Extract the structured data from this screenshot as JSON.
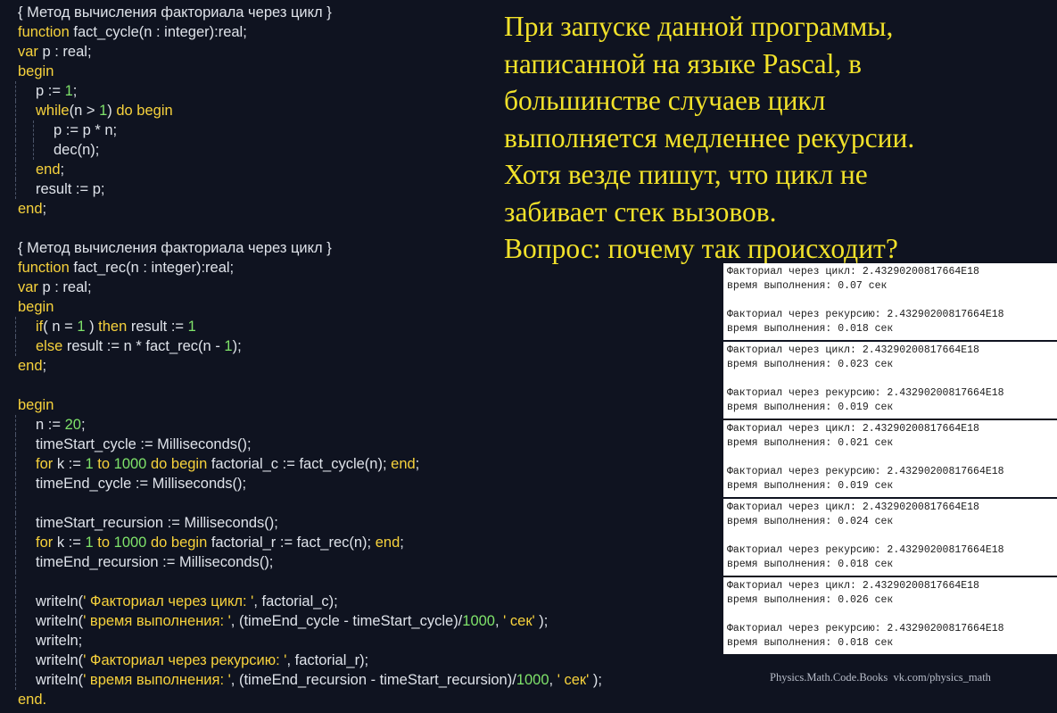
{
  "code_lines": [
    {
      "indent": 0,
      "tokens": [
        [
          "plain",
          "{ Метод вычисления факториала через цикл }"
        ]
      ]
    },
    {
      "indent": 0,
      "tokens": [
        [
          "kw",
          "function"
        ],
        [
          "plain",
          " fact_cycle(n : integer):real;"
        ]
      ]
    },
    {
      "indent": 0,
      "tokens": [
        [
          "kw",
          "var"
        ],
        [
          "plain",
          " p : real;"
        ]
      ]
    },
    {
      "indent": 0,
      "tokens": [
        [
          "kw",
          "begin"
        ]
      ]
    },
    {
      "indent": 1,
      "tokens": [
        [
          "plain",
          "p := "
        ],
        [
          "num",
          "1"
        ],
        [
          "plain",
          ";"
        ]
      ]
    },
    {
      "indent": 1,
      "tokens": [
        [
          "kw",
          "while"
        ],
        [
          "plain",
          "(n > "
        ],
        [
          "num",
          "1"
        ],
        [
          "plain",
          ") "
        ],
        [
          "kw",
          "do begin"
        ]
      ]
    },
    {
      "indent": 2,
      "tokens": [
        [
          "plain",
          "p := p * n;"
        ]
      ]
    },
    {
      "indent": 2,
      "tokens": [
        [
          "plain",
          "dec(n);"
        ]
      ]
    },
    {
      "indent": 1,
      "tokens": [
        [
          "kw",
          "end"
        ],
        [
          "plain",
          ";"
        ]
      ]
    },
    {
      "indent": 1,
      "tokens": [
        [
          "plain",
          "result := p;"
        ]
      ]
    },
    {
      "indent": 0,
      "tokens": [
        [
          "kw",
          "end"
        ],
        [
          "plain",
          ";"
        ]
      ]
    },
    {
      "indent": 0,
      "tokens": []
    },
    {
      "indent": 0,
      "tokens": [
        [
          "plain",
          "{ Метод вычисления факториала через цикл }"
        ]
      ]
    },
    {
      "indent": 0,
      "tokens": [
        [
          "kw",
          "function"
        ],
        [
          "plain",
          " fact_rec(n : integer):real;"
        ]
      ]
    },
    {
      "indent": 0,
      "tokens": [
        [
          "kw",
          "var"
        ],
        [
          "plain",
          " p : real;"
        ]
      ]
    },
    {
      "indent": 0,
      "tokens": [
        [
          "kw",
          "begin"
        ]
      ]
    },
    {
      "indent": 1,
      "tokens": [
        [
          "kw",
          "if"
        ],
        [
          "plain",
          "( n = "
        ],
        [
          "num",
          "1"
        ],
        [
          "plain",
          " ) "
        ],
        [
          "kw",
          "then"
        ],
        [
          "plain",
          " result := "
        ],
        [
          "num",
          "1"
        ]
      ]
    },
    {
      "indent": 1,
      "tokens": [
        [
          "kw",
          "else"
        ],
        [
          "plain",
          " result := n * fact_rec(n - "
        ],
        [
          "num",
          "1"
        ],
        [
          "plain",
          ");"
        ]
      ]
    },
    {
      "indent": 0,
      "tokens": [
        [
          "kw",
          "end"
        ],
        [
          "plain",
          ";"
        ]
      ]
    },
    {
      "indent": 0,
      "tokens": []
    },
    {
      "indent": 0,
      "tokens": [
        [
          "kw",
          "begin"
        ]
      ]
    },
    {
      "indent": 1,
      "tokens": [
        [
          "plain",
          "n := "
        ],
        [
          "num",
          "20"
        ],
        [
          "plain",
          ";"
        ]
      ]
    },
    {
      "indent": 1,
      "tokens": [
        [
          "plain",
          "timeStart_cycle := Milliseconds();"
        ]
      ]
    },
    {
      "indent": 1,
      "tokens": [
        [
          "kw",
          "for"
        ],
        [
          "plain",
          " k := "
        ],
        [
          "num",
          "1"
        ],
        [
          "plain",
          " "
        ],
        [
          "kw",
          "to"
        ],
        [
          "plain",
          " "
        ],
        [
          "num",
          "1000"
        ],
        [
          "plain",
          " "
        ],
        [
          "kw",
          "do begin"
        ],
        [
          "plain",
          " factorial_c := fact_cycle(n); "
        ],
        [
          "kw",
          "end"
        ],
        [
          "plain",
          ";"
        ]
      ]
    },
    {
      "indent": 1,
      "tokens": [
        [
          "plain",
          "timeEnd_cycle := Milliseconds();"
        ]
      ]
    },
    {
      "indent": 1,
      "tokens": []
    },
    {
      "indent": 1,
      "tokens": [
        [
          "plain",
          "timeStart_recursion := Milliseconds();"
        ]
      ]
    },
    {
      "indent": 1,
      "tokens": [
        [
          "kw",
          "for"
        ],
        [
          "plain",
          " k := "
        ],
        [
          "num",
          "1"
        ],
        [
          "plain",
          " "
        ],
        [
          "kw",
          "to"
        ],
        [
          "plain",
          " "
        ],
        [
          "num",
          "1000"
        ],
        [
          "plain",
          " "
        ],
        [
          "kw",
          "do begin"
        ],
        [
          "plain",
          " factorial_r := fact_rec(n); "
        ],
        [
          "kw",
          "end"
        ],
        [
          "plain",
          ";"
        ]
      ]
    },
    {
      "indent": 1,
      "tokens": [
        [
          "plain",
          "timeEnd_recursion := Milliseconds();"
        ]
      ]
    },
    {
      "indent": 1,
      "tokens": []
    },
    {
      "indent": 1,
      "tokens": [
        [
          "plain",
          "writeln("
        ],
        [
          "kw",
          "' Факториал через цикл: '"
        ],
        [
          "plain",
          ", factorial_c);"
        ]
      ]
    },
    {
      "indent": 1,
      "tokens": [
        [
          "plain",
          "writeln("
        ],
        [
          "kw",
          "' время выполнения: '"
        ],
        [
          "plain",
          ", (timeEnd_cycle - timeStart_cycle)/"
        ],
        [
          "num",
          "1000"
        ],
        [
          "plain",
          ", "
        ],
        [
          "kw",
          "' сек'"
        ],
        [
          "plain",
          " );"
        ]
      ]
    },
    {
      "indent": 1,
      "tokens": [
        [
          "plain",
          "writeln;"
        ]
      ]
    },
    {
      "indent": 1,
      "tokens": [
        [
          "plain",
          "writeln("
        ],
        [
          "kw",
          "' Факториал через рекурсию: '"
        ],
        [
          "plain",
          ", factorial_r);"
        ]
      ]
    },
    {
      "indent": 1,
      "tokens": [
        [
          "plain",
          "writeln("
        ],
        [
          "kw",
          "' время выполнения: '"
        ],
        [
          "plain",
          ", (timeEnd_recursion - timeStart_recursion)/"
        ],
        [
          "num",
          "1000"
        ],
        [
          "plain",
          ", "
        ],
        [
          "kw",
          "' сек'"
        ],
        [
          "plain",
          " );"
        ]
      ]
    },
    {
      "indent": 0,
      "tokens": [
        [
          "kw",
          "end."
        ]
      ]
    }
  ],
  "question_lines": [
    "При запуске данной программы,",
    "написанной на языке Pascal, в",
    "большинстве случаев цикл",
    "выполняется медленнее рекурсии.",
    "Хотя везде пишут, что цикл не",
    "забивает стек вызовов.",
    "Вопрос: почему так происходит?"
  ],
  "output_panels": [
    [
      "Факториал через цикл: 2.43290200817664E18",
      "время выполнения: 0.07 сек",
      "",
      "Факториал через рекурсию: 2.43290200817664E18",
      "время выполнения: 0.018 сек"
    ],
    [
      "Факториал через цикл: 2.43290200817664E18",
      "время выполнения: 0.023 сек",
      "",
      "Факториал через рекурсию: 2.43290200817664E18",
      "время выполнения: 0.019 сек"
    ],
    [
      "Факториал через цикл: 2.43290200817664E18",
      "время выполнения: 0.021 сек",
      "",
      "Факториал через рекурсию: 2.43290200817664E18",
      "время выполнения: 0.019 сек"
    ],
    [
      "Факториал через цикл: 2.43290200817664E18",
      "время выполнения: 0.024 сек",
      "",
      "Факториал через рекурсию: 2.43290200817664E18",
      "время выполнения: 0.018 сек"
    ],
    [
      "Факториал через цикл: 2.43290200817664E18",
      "время выполнения: 0.026 сек",
      "",
      "Факториал через рекурсию: 2.43290200817664E18",
      "время выполнения: 0.018 сек"
    ]
  ],
  "footer": "Physics.Math.Code.Books  vk.com/physics_math",
  "colors": {
    "background": "#0f1320",
    "keyword": "#f7d23c",
    "number": "#7fe36a",
    "text": "#dfe3ea",
    "question": "#f2e22a"
  }
}
